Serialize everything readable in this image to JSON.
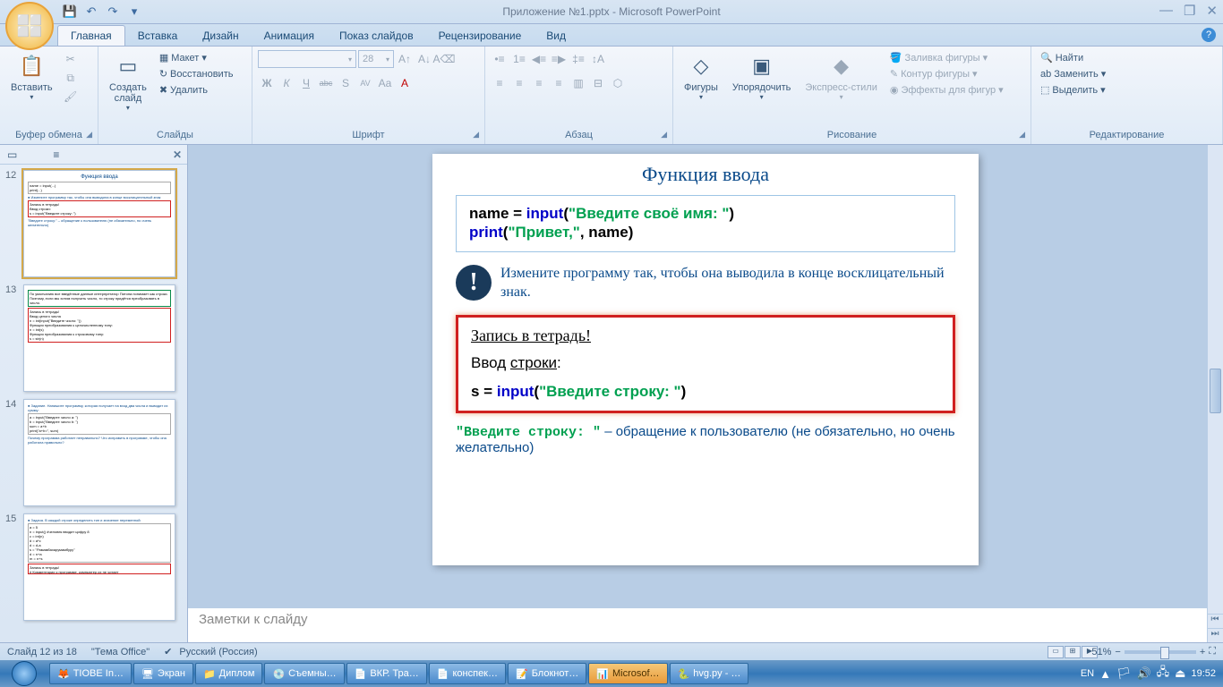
{
  "title": "Приложение №1.pptx - Microsoft PowerPoint",
  "qat": {
    "save": "💾",
    "undo": "↶",
    "redo": "↷",
    "more": "▾"
  },
  "window": {
    "min": "—",
    "max": "❐",
    "close": "✕"
  },
  "tabs": {
    "home": "Главная",
    "insert": "Вставка",
    "design": "Дизайн",
    "anim": "Анимация",
    "show": "Показ слайдов",
    "review": "Рецензирование",
    "view": "Вид"
  },
  "ribbon": {
    "clipboard": {
      "label": "Буфер обмена",
      "paste": "Вставить"
    },
    "slides": {
      "label": "Слайды",
      "new": "Создать\nслайд",
      "layout": "Макет",
      "reset": "Восстановить",
      "delete": "Удалить"
    },
    "font": {
      "label": "Шрифт",
      "size": "28",
      "bold": "Ж",
      "italic": "К",
      "under": "Ч",
      "strike": "abc",
      "shadow": "S",
      "char": "AV",
      "case": "Aa",
      "clear": "A"
    },
    "para": {
      "label": "Абзац"
    },
    "draw": {
      "label": "Рисование",
      "shapes": "Фигуры",
      "arrange": "Упорядочить",
      "styles": "Экспресс-стили",
      "fill": "Заливка фигуры",
      "outline": "Контур фигуры",
      "effects": "Эффекты для фигур"
    },
    "edit": {
      "label": "Редактирование",
      "find": "Найти",
      "replace": "Заменить",
      "select": "Выделить"
    }
  },
  "panel_tabs": {
    "slides_icon": "▭",
    "outline_icon": "≡"
  },
  "thumbs": [
    {
      "num": "12",
      "title": "Функция ввода"
    },
    {
      "num": "13",
      "title": ""
    },
    {
      "num": "14",
      "title": ""
    },
    {
      "num": "15",
      "title": ""
    }
  ],
  "slide": {
    "title": "Функция ввода",
    "code1_a": "name = ",
    "code1_fn": "input",
    "code1_b": "(",
    "code1_s": "\"Введите своё имя: \"",
    "code1_c": ")",
    "code2_fn": "print",
    "code2_a": "(",
    "code2_s": "\"Привет,\"",
    "code2_b": ", name)",
    "excl": "!",
    "note": "Измените программу так, чтобы она выводила в конце восклицательный знак.",
    "red_hdr": "Запись в тетрадь!",
    "red_lbl_a": "Ввод ",
    "red_lbl_u": "строки",
    "red_lbl_b": ":",
    "red_code_a": "s = ",
    "red_code_fn": "input",
    "red_code_b": "(",
    "red_code_s": "\"Введите строку: \"",
    "red_code_c": ")",
    "foot_s": "\"Введите строку: \"",
    "foot_rest": " – обращение к пользователю (не обязательно, но очень желательно)"
  },
  "notes_placeholder": "Заметки к слайду",
  "status": {
    "slide": "Слайд 12 из 18",
    "theme": "\"Тема Office\"",
    "lang": "Русский (Россия)",
    "zoom": "51%"
  },
  "taskbar": {
    "items": [
      {
        "label": "TIOBE In…",
        "ic": "🦊"
      },
      {
        "label": "Экран",
        "ic": "🖥"
      },
      {
        "label": "Диплом",
        "ic": "📁"
      },
      {
        "label": "Съемны…",
        "ic": "💿"
      },
      {
        "label": "ВКР. Тра…",
        "ic": "📄"
      },
      {
        "label": "конспек…",
        "ic": "📄"
      },
      {
        "label": "Блокнот…",
        "ic": "📝"
      },
      {
        "label": "Microsof…",
        "ic": "📊",
        "active": true
      },
      {
        "label": "hvg.py - …",
        "ic": "🐍"
      }
    ],
    "lang": "EN",
    "time": "19:52"
  }
}
